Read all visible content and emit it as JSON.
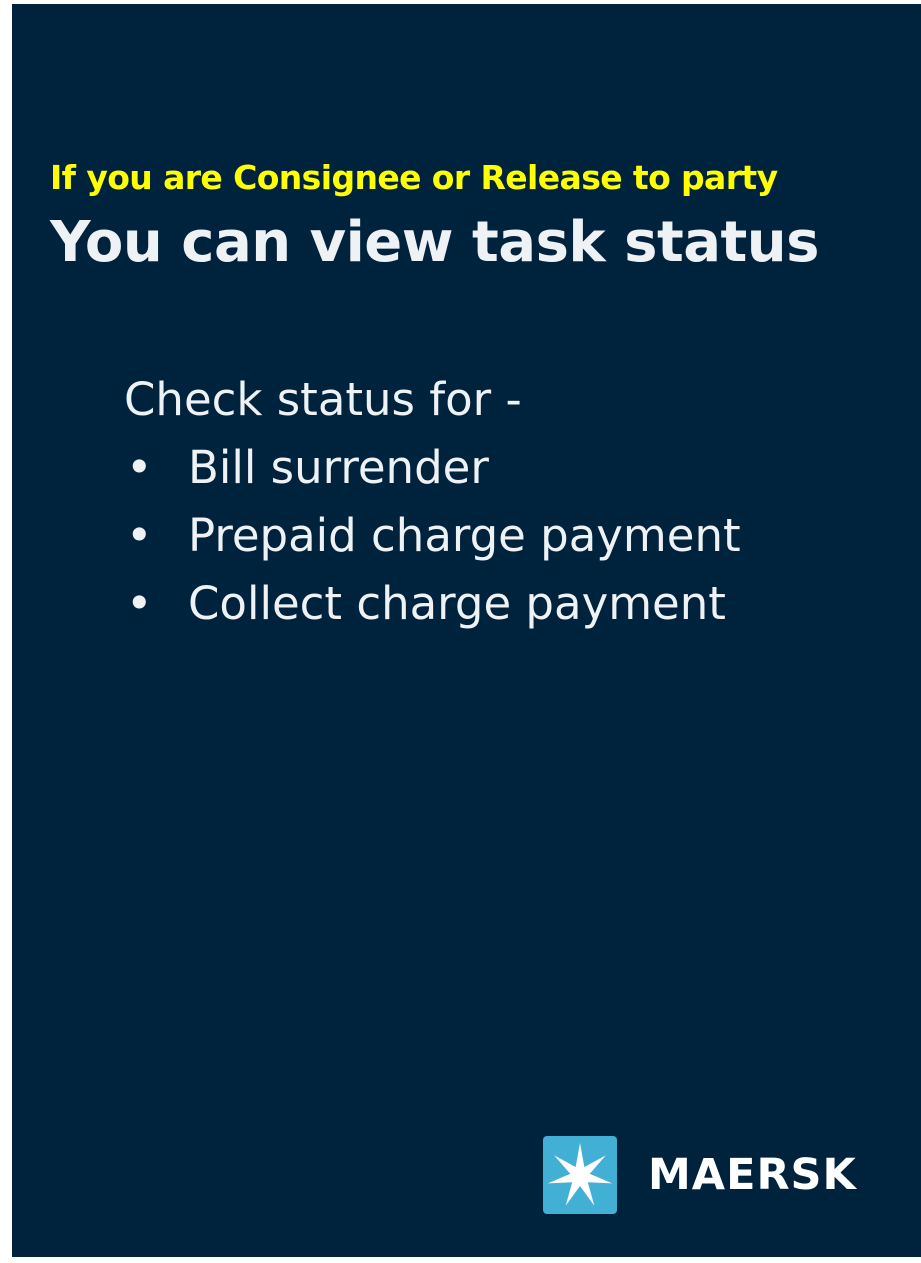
{
  "slide": {
    "subtitle": "If you are Consignee or Release to party",
    "title": "You can view task status",
    "check_heading": "Check status for -",
    "bullets": [
      "Bill surrender",
      "Prepaid charge payment",
      "Collect charge payment"
    ],
    "bullet_symbol": "•"
  },
  "brand": {
    "logo_icon": "seven-pointed-star-icon",
    "logo_text": "MAERSK",
    "colors": {
      "background": "#00233d",
      "accent_yellow": "#ffff00",
      "logo_blue": "#42b0d5",
      "text": "#eef2f5"
    }
  }
}
